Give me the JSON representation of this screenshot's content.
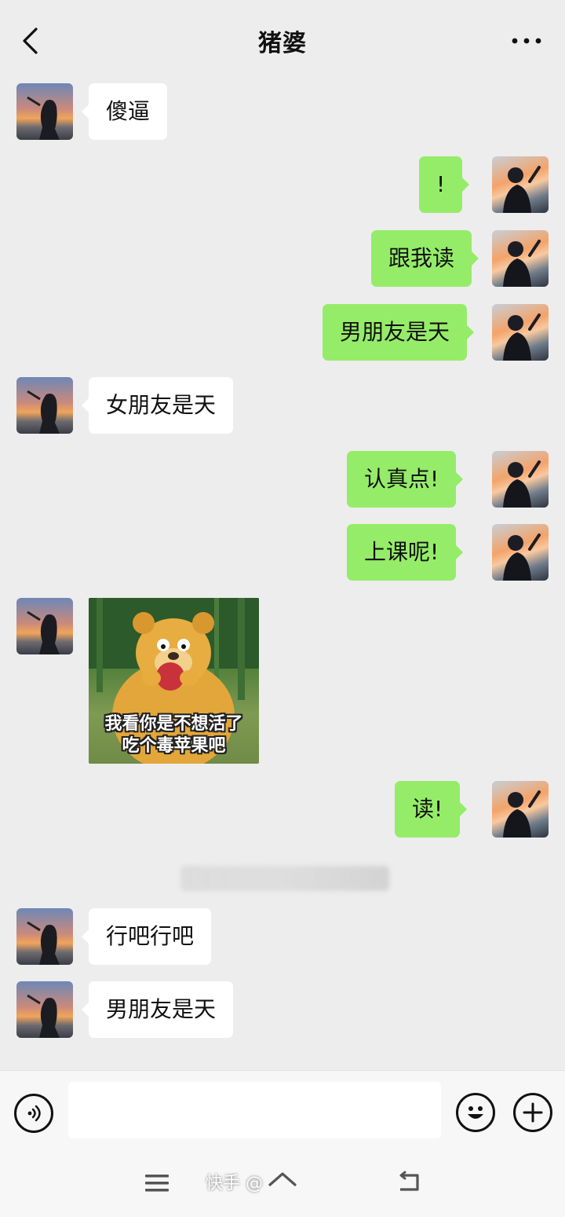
{
  "header": {
    "title": "猪婆"
  },
  "messages": [
    {
      "side": "left",
      "text": "傻逼"
    },
    {
      "side": "right",
      "text": "!"
    },
    {
      "side": "right",
      "text": "跟我读"
    },
    {
      "side": "right",
      "text": "男朋友是天"
    },
    {
      "side": "left",
      "text": "女朋友是天"
    },
    {
      "side": "right",
      "text": "认真点!"
    },
    {
      "side": "right",
      "text": "上课呢!"
    },
    {
      "side": "left",
      "type": "sticker",
      "caption_line1": "我看你是不想活了",
      "caption_line2": "吃个毒苹果吧"
    },
    {
      "side": "right",
      "text": "读!"
    },
    {
      "side": "left",
      "text": "行吧行吧"
    },
    {
      "side": "left",
      "text": "男朋友是天"
    }
  ],
  "input": {
    "value": "",
    "placeholder": ""
  },
  "watermark": {
    "text": "快手 @"
  },
  "icons": {
    "back": "chevron-left-icon",
    "more": "more-dots-icon",
    "voice": "voice-icon",
    "emoji": "emoji-icon",
    "plus": "plus-icon",
    "menu": "menu-icon",
    "home": "home-icon",
    "return": "return-icon"
  },
  "colors": {
    "background": "#ededed",
    "bubble_sent": "#95ec69",
    "bubble_received": "#ffffff"
  }
}
